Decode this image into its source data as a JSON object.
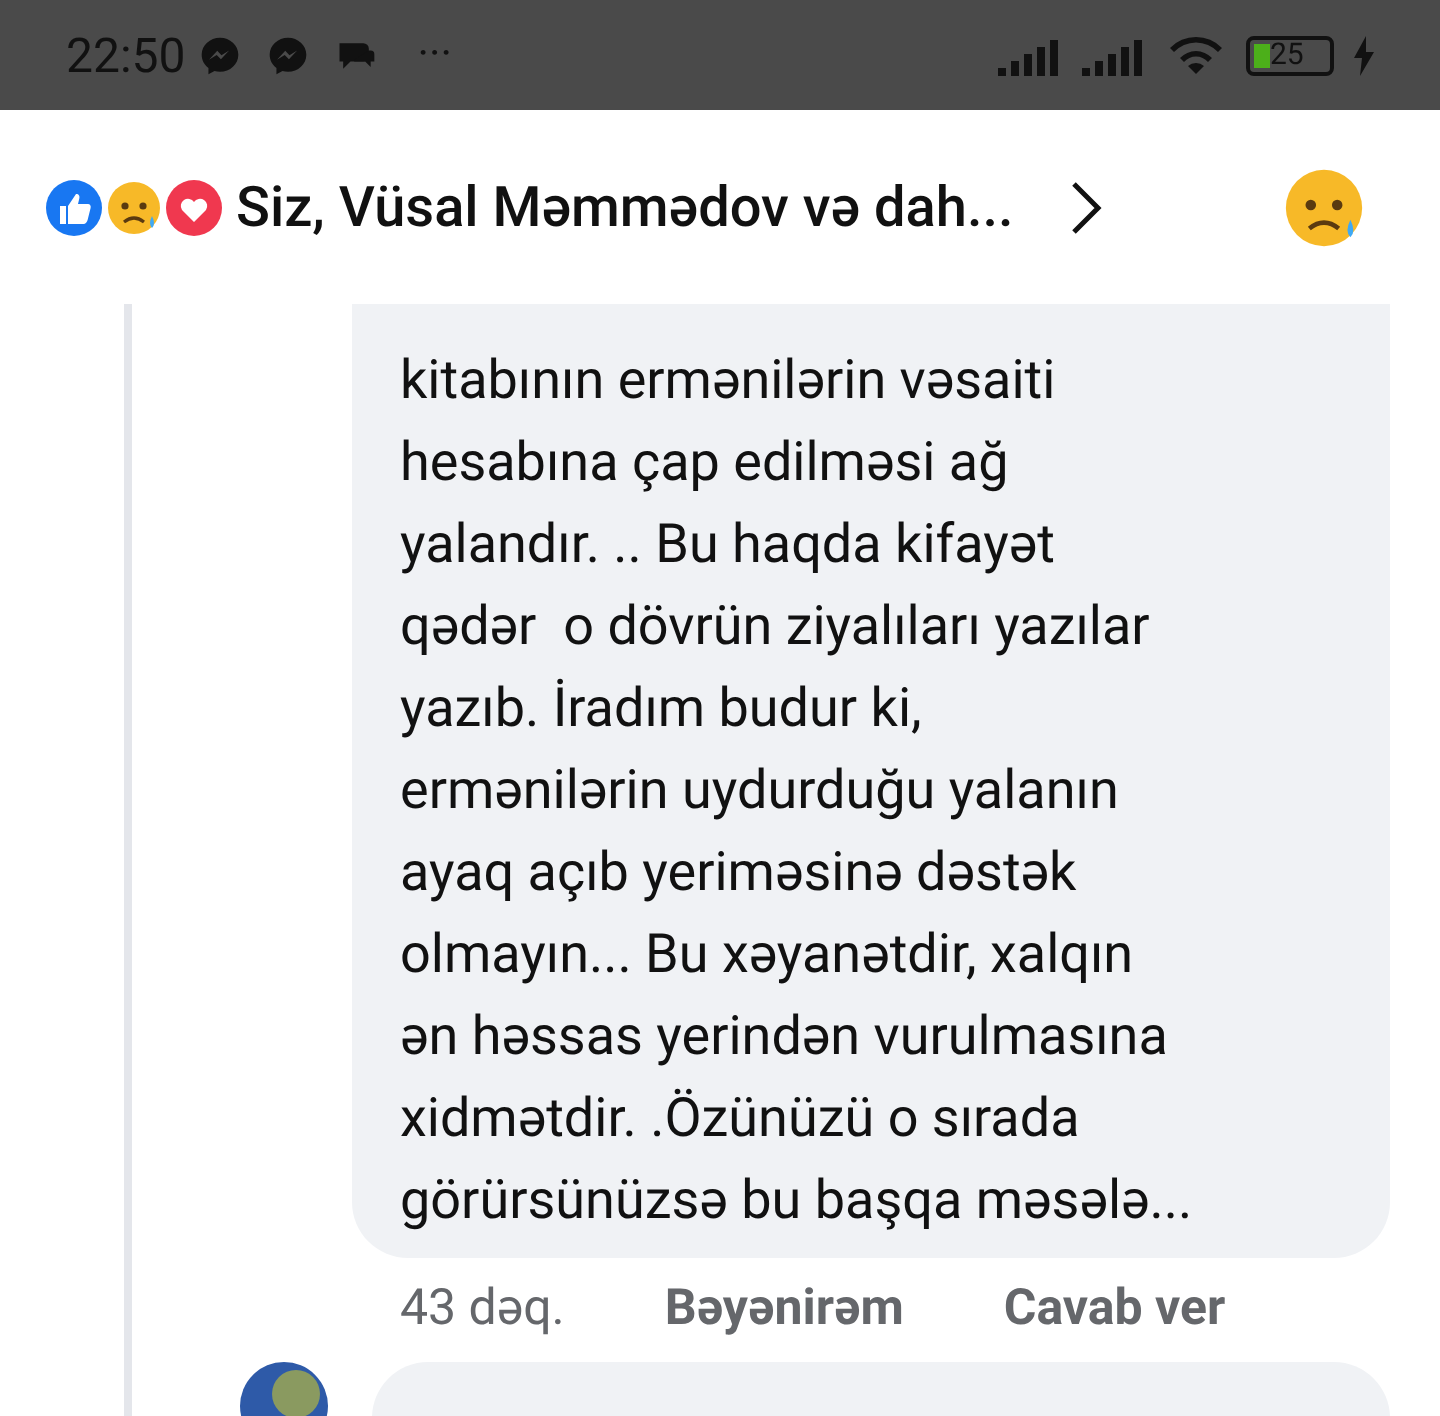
{
  "status_bar": {
    "time": "22:50",
    "more": "···",
    "battery": "25"
  },
  "reactions_header": {
    "summary": "Siz, Vüsal Məmmədov və dah..."
  },
  "comment": {
    "lines": [
      "kitabının ermənilərin vəsaiti",
      "hesabına çap edilməsi ağ",
      "yalandır. .. Bu haqda kifayət",
      "qədər  o dövrün ziyalıları yazılar",
      "yazıb. İradım budur ki,",
      "ermənilərin uydurduğu yalanın",
      "ayaq açıb yeriməsinə dəstək",
      "olmayın... Bu xəyanətdir, xalqın",
      "ən həssas yerindən vurulmasına",
      "xidmətdir. .Özünüzü o sırada",
      "görürsünüzsə bu başqa məsələ..."
    ],
    "time": "43 dəq.",
    "actions": [
      "Bəyənirəm",
      "Cavab ver"
    ]
  }
}
